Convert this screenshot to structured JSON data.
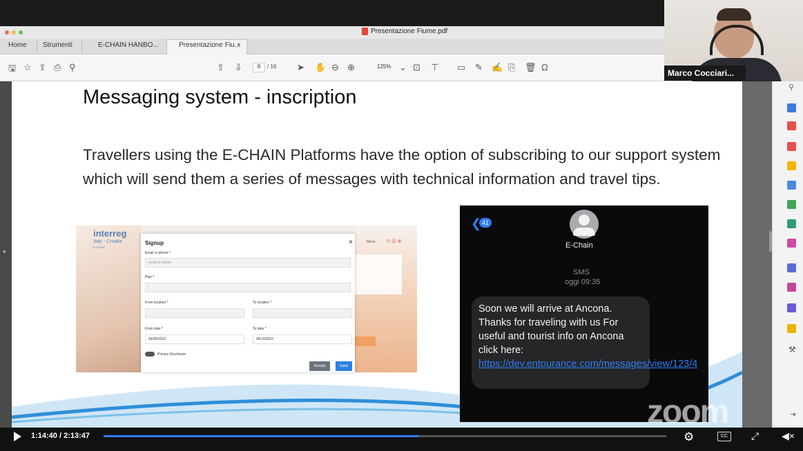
{
  "pdf_window": {
    "title": "Presentazione Fiume.pdf",
    "tabs": [
      "Home",
      "Strumenti",
      "E-CHAIN HANBO...",
      "Presentazione Fiu..."
    ],
    "close_tab": "×",
    "page_current": "8",
    "page_total": "/ 16",
    "zoom": "125%"
  },
  "slide": {
    "title": "Messaging system - inscription",
    "body": "Travellers using the E-CHAIN Platforms have the option of subscribing to our support system which will send them a series of messages with technical information and travel tips."
  },
  "signup_form": {
    "logo_line1": "interreg",
    "logo_line2": "Italy - Croatia",
    "logo_line3": "E-CHAIN",
    "title": "Signup",
    "close": "×",
    "email_label": "Email or phone *",
    "email_placeholder": "email or phone",
    "plan_label": "Plan *",
    "plan_value": "-",
    "from_location_label": "From location *",
    "to_location_label": "To location *",
    "from_date_label": "From date *",
    "from_date_value": "06/05/2022",
    "to_date_label": "To date *",
    "to_date_value": "06/10/2022",
    "privacy_label": "Privacy Disclosure",
    "cancel_button": "Annulla",
    "save_button": "Salva",
    "header_menu": "Menu"
  },
  "sms": {
    "back_count": "41",
    "contact": "E-Chain",
    "service": "SMS",
    "time": "oggi 09:35",
    "message": "Soon we will arrive at Ancona. Thanks for traveling with us For useful and tourist info on Ancona click here: ",
    "link": "https://dev.entourance.com/messages/view/123/4"
  },
  "webcam": {
    "name": "Marco Cocciari..."
  },
  "watermark": "zoom",
  "player": {
    "time": "1:14:40 / 2:13:47",
    "progress": 0.56,
    "cc": "CC"
  },
  "colors": {
    "progress": "#2f7cf6",
    "sms_link": "#2f7df6",
    "pdf_red": "#e8433b"
  }
}
